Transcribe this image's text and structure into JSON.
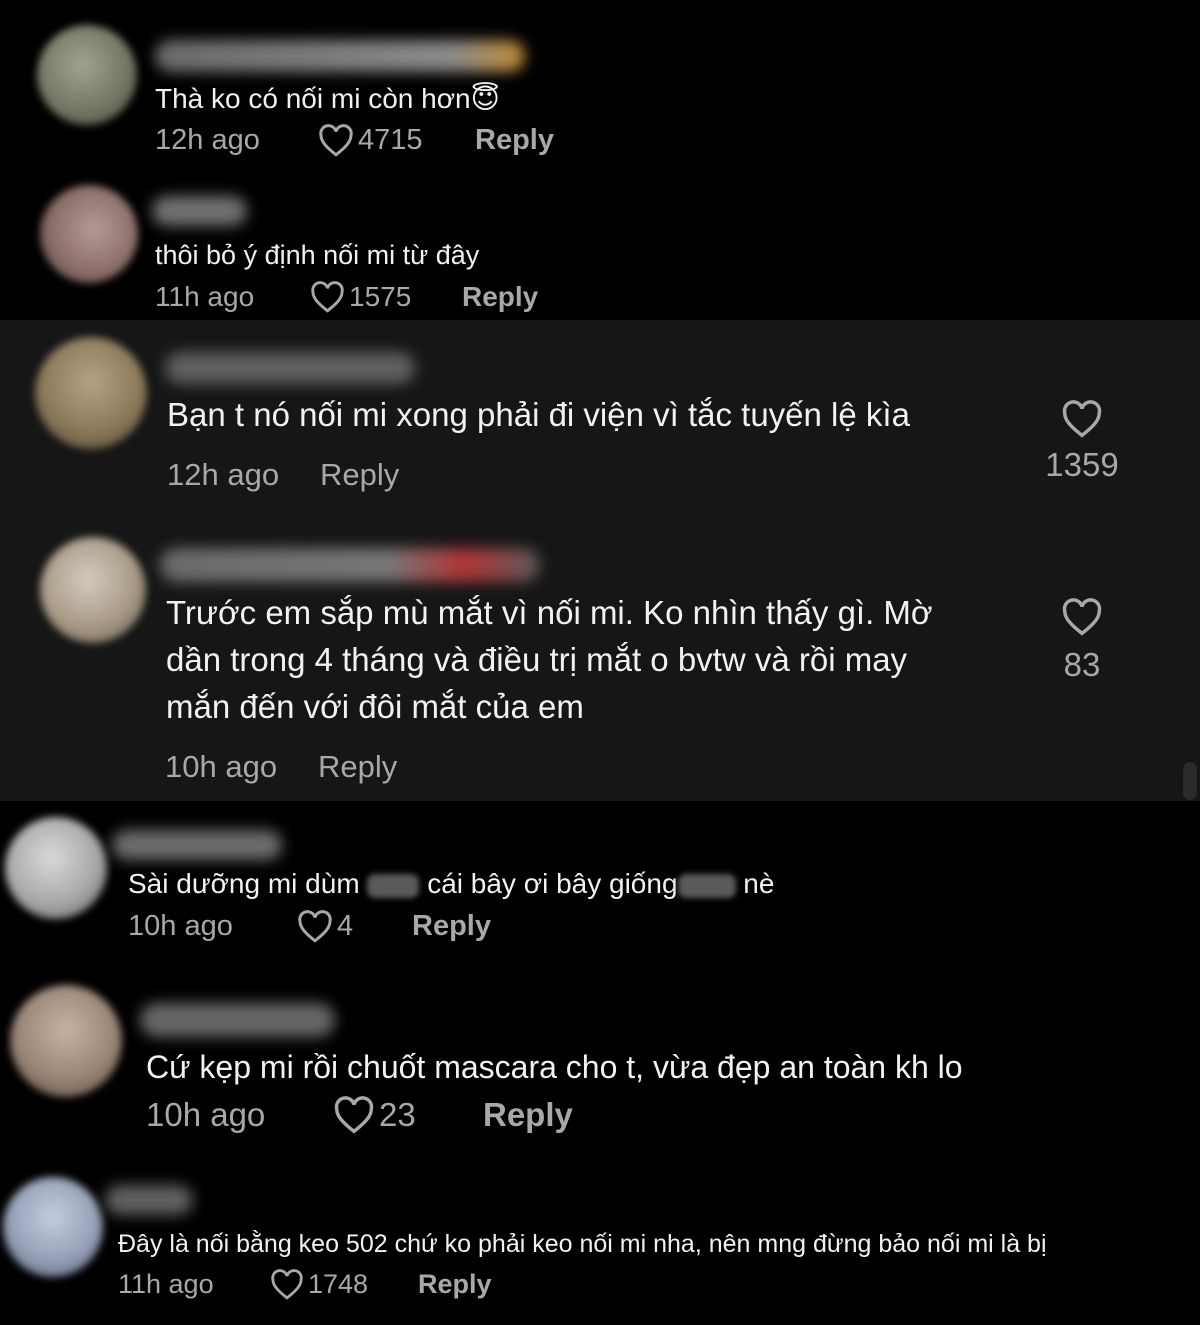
{
  "heart_icon": "heart-outline-icon",
  "colors": {
    "background": "#000000",
    "panel": "#161616",
    "secondary_text": "#a8a8a8",
    "primary_text": "#f2f2f2"
  },
  "comments": [
    {
      "text": "Thà ko có nối mi còn hơn",
      "emoji": "😇",
      "time": "12h ago",
      "likes": "4715",
      "reply": "Reply"
    },
    {
      "text": "thôi bỏ ý định nối mi từ đây",
      "time": "11h ago",
      "likes": "1575",
      "reply": "Reply"
    },
    {
      "text": "Bạn t nó nối mi xong phải đi viện vì tắc tuyến lệ kìa",
      "time": "12h ago",
      "likes": "1359",
      "reply": "Reply"
    },
    {
      "text_lines": [
        "Trước em sắp mù mắt vì nối mi. Ko nhìn thấy gì. Mờ",
        "dần trong 4 tháng và điều trị mắt o bvtw và rồi may",
        "mắn đến với đôi mắt của em"
      ],
      "time": "10h ago",
      "likes": "83",
      "reply": "Reply"
    },
    {
      "text_a": "Sài dưỡng mi dùm",
      "text_b": "cái bây ơi bây giống",
      "text_c": "nè",
      "time": "10h ago",
      "likes": "4",
      "reply": "Reply"
    },
    {
      "text": "Cứ kẹp mi rồi chuốt mascara cho t, vừa đẹp an toàn kh lo",
      "time": "10h ago",
      "likes": "23",
      "reply": "Reply"
    },
    {
      "text": "Đây là nối bằng keo 502 chứ ko phải keo nối mi nha, nên mng đừng bảo nối mi là bị",
      "time": "11h ago",
      "likes": "1748",
      "reply": "Reply"
    }
  ]
}
